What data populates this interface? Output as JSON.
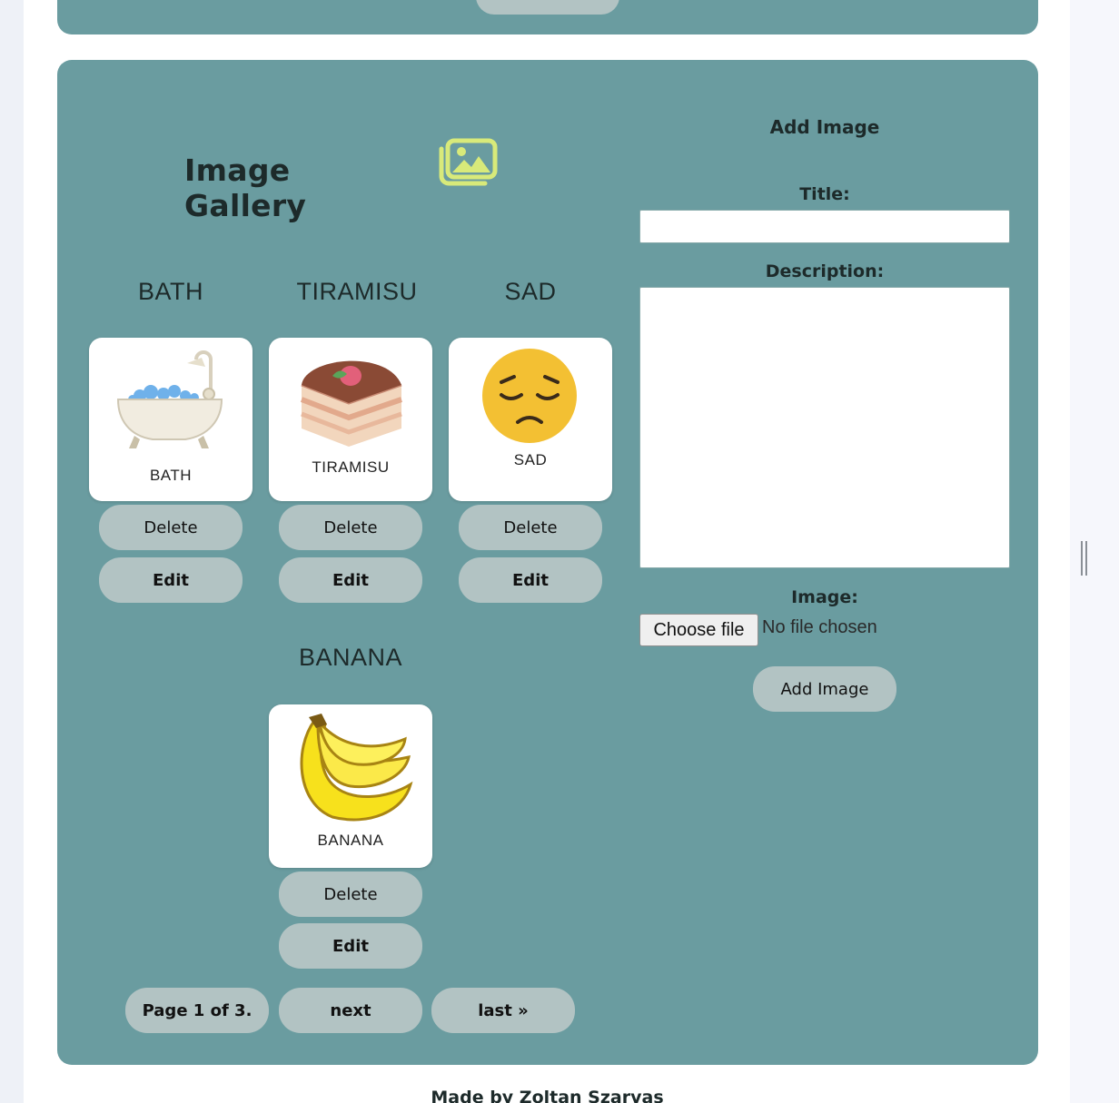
{
  "gallery": {
    "title": "Image Gallery",
    "icon": "image-gallery-icon",
    "accent_color": "#d8ea7a",
    "items": [
      {
        "title": "BATH",
        "caption": "BATH",
        "image": "bathtub-icon",
        "delete_label": "Delete",
        "edit_label": "Edit"
      },
      {
        "title": "TIRAMISU",
        "caption": "TIRAMISU",
        "image": "tiramisu-icon",
        "delete_label": "Delete",
        "edit_label": "Edit"
      },
      {
        "title": "SAD",
        "caption": "SAD",
        "image": "sad-face-icon",
        "delete_label": "Delete",
        "edit_label": "Edit"
      },
      {
        "title": "BANANA",
        "caption": "BANANA",
        "image": "banana-icon",
        "delete_label": "Delete",
        "edit_label": "Edit"
      }
    ],
    "pagination": {
      "page_info": "Page 1 of 3.",
      "next": "next",
      "last": "last »"
    }
  },
  "form": {
    "heading": "Add Image",
    "title_label": "Title:",
    "title_value": "",
    "description_label": "Description:",
    "description_value": "",
    "image_label": "Image:",
    "file_button": "Choose file",
    "file_status": "No file chosen",
    "submit": "Add Image"
  },
  "footer": {
    "text": "Made by Zoltan Szarvas"
  },
  "colors": {
    "panel": "#6a9ca0",
    "button": "#b2c3c3",
    "background": "#eef1f7"
  }
}
